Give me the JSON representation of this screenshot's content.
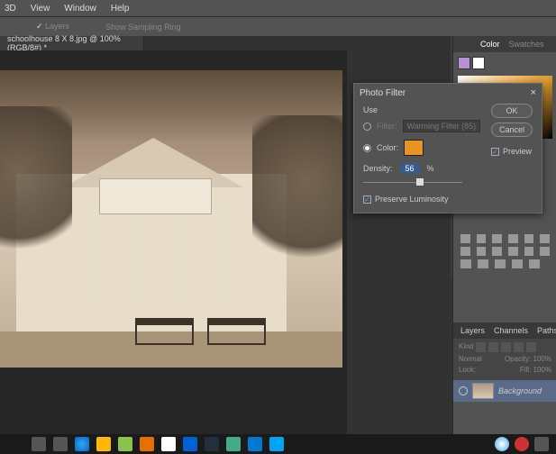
{
  "menu": {
    "items": [
      "3D",
      "View",
      "Window",
      "Help"
    ]
  },
  "optionsbar": {
    "item1": "Layers",
    "item2": "Show Sampling Ring"
  },
  "tab": {
    "title": "schoolhouse 8 X 8.jpg @ 100% (RGB/8#) *"
  },
  "dialog": {
    "title": "Photo Filter",
    "use_label": "Use",
    "filter_label": "Filter:",
    "filter_value": "Warming Filter (85)",
    "color_label": "Color:",
    "color_hex": "#e89420",
    "ok": "OK",
    "cancel": "Cancel",
    "preview_label": "Preview",
    "preview_checked": true,
    "density_label": "Density:",
    "density_value": "56",
    "density_suffix": "%",
    "preserve_label": "Preserve Luminosity",
    "preserve_checked": true,
    "selected_radio": "color"
  },
  "color_panel": {
    "tab1": "Color",
    "tab2": "Swatches"
  },
  "layers_panel": {
    "tab1": "Layers",
    "tab2": "Channels",
    "tab3": "Paths",
    "kind_label": "Kind",
    "blend": "Normal",
    "opacity_label": "Opacity:",
    "opacity_val": "100%",
    "lock_label": "Lock:",
    "fill_label": "Fill:",
    "fill_val": "100%",
    "layer_name": "Background"
  }
}
